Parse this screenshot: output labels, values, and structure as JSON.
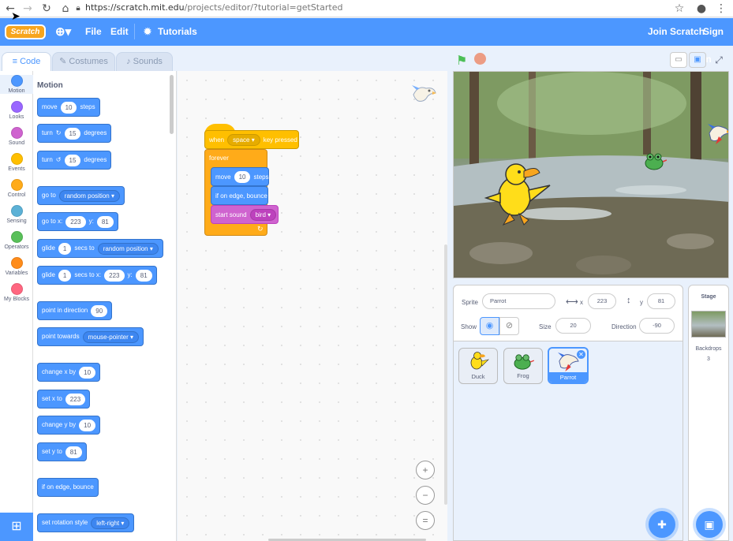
{
  "browser": {
    "url_host": "https://scratch.mit.edu",
    "url_path": "/projects/editor/?tutorial=getStarted"
  },
  "menubar": {
    "logo": "Scratch",
    "file": "File",
    "edit": "Edit",
    "tutorials": "Tutorials",
    "join": "Join Scratch",
    "signin": "Sign in"
  },
  "tabs": {
    "code": "Code",
    "costumes": "Costumes",
    "sounds": "Sounds"
  },
  "categories": [
    {
      "label": "Motion",
      "color": "#4c97ff"
    },
    {
      "label": "Looks",
      "color": "#9966ff"
    },
    {
      "label": "Sound",
      "color": "#cf63cf"
    },
    {
      "label": "Events",
      "color": "#ffbf00"
    },
    {
      "label": "Control",
      "color": "#ffab19"
    },
    {
      "label": "Sensing",
      "color": "#5cb1d6"
    },
    {
      "label": "Operators",
      "color": "#59c059"
    },
    {
      "label": "Variables",
      "color": "#ff8c1a"
    },
    {
      "label": "My Blocks",
      "color": "#ff6680"
    }
  ],
  "palette": {
    "heading": "Motion",
    "move": {
      "t1": "move",
      "v": "10",
      "t2": "steps"
    },
    "turn_right": {
      "t1": "turn",
      "v": "15",
      "t2": "degrees"
    },
    "turn_left": {
      "t1": "turn",
      "v": "15",
      "t2": "degrees"
    },
    "goto": {
      "t1": "go to",
      "dd": "random position"
    },
    "gotoxy": {
      "t1": "go to x:",
      "x": "223",
      "t2": "y:",
      "y": "81"
    },
    "glide_to": {
      "t1": "glide",
      "v": "1",
      "t2": "secs to",
      "dd": "random position"
    },
    "glide_xy": {
      "t1": "glide",
      "v": "1",
      "t2": "secs to x:",
      "x": "223",
      "t3": "y:",
      "y": "81"
    },
    "point_dir": {
      "t1": "point in direction",
      "v": "90"
    },
    "point_towards": {
      "t1": "point towards",
      "dd": "mouse-pointer"
    },
    "change_x": {
      "t1": "change x by",
      "v": "10"
    },
    "set_x": {
      "t1": "set x to",
      "v": "223"
    },
    "change_y": {
      "t1": "change y by",
      "v": "10"
    },
    "set_y": {
      "t1": "set y to",
      "v": "81"
    },
    "bounce": {
      "t1": "if on edge, bounce"
    },
    "rotation": {
      "t1": "set rotation style",
      "dd": "left-right"
    }
  },
  "script": {
    "when": "when",
    "key": "space",
    "pressed": "key pressed",
    "forever": "forever",
    "move": "move",
    "move_v": "10",
    "steps": "steps",
    "bounce": "if on edge, bounce",
    "sound": "start sound",
    "sound_dd": "bird"
  },
  "zoom": {
    "in": "+",
    "out": "−",
    "reset": "="
  },
  "sprite_info": {
    "sprite_label": "Sprite",
    "sprite_name": "Parrot",
    "x_label": "x",
    "x": "223",
    "y_label": "y",
    "y": "81",
    "show_label": "Show",
    "size_label": "Size",
    "size": "20",
    "direction_label": "Direction",
    "direction": "-90"
  },
  "sprites": [
    {
      "name": "Duck"
    },
    {
      "name": "Frog"
    },
    {
      "name": "Parrot"
    }
  ],
  "stage_pane": {
    "title": "Stage",
    "backdrops_label": "Backdrops",
    "backdrops_count": "3"
  },
  "colors": {
    "scratch_blue": "#4c97ff",
    "events": "#ffbf00",
    "control": "#ffab19",
    "sound": "#cf63cf"
  }
}
